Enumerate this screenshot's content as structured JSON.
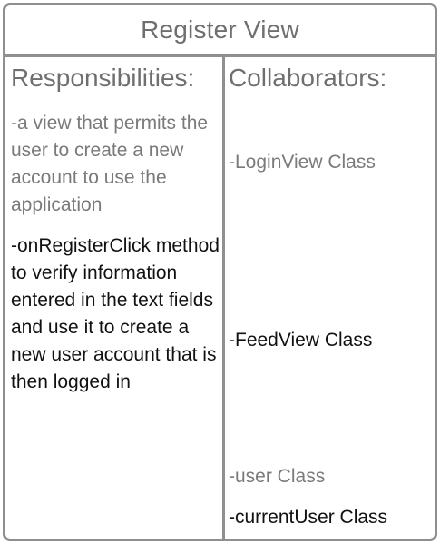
{
  "card": {
    "title": "Register View",
    "responsibilities_header": "Responsibilities:",
    "collaborators_header": "Collaborators:",
    "responsibilities": [
      "-a view that permits the user to create a new account to use the application",
      "-onRegisterClick method to verify information entered in the text fields and use it to create a new user account that is then logged in"
    ],
    "collaborators": [
      "-LoginView Class",
      "-FeedView Class",
      "-user Class",
      "-currentUser Class"
    ]
  },
  "colors": {
    "border": "#8f8f8f",
    "muted_text": "#7a7a7a",
    "dark_text": "#111111"
  }
}
